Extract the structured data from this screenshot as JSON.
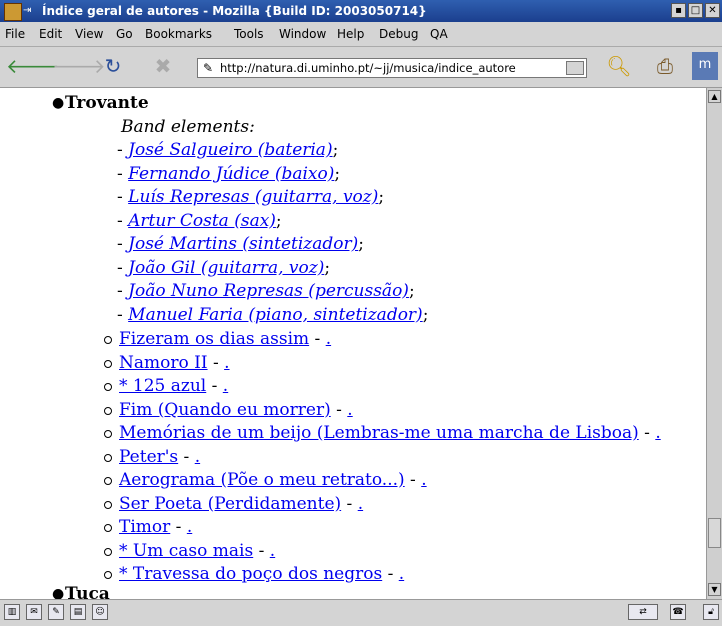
{
  "window": {
    "title": "Índice geral de autores - Mozilla {Build ID: 2003050714}"
  },
  "menu": [
    "File",
    "Edit",
    "View",
    "Go",
    "Bookmarks",
    "Tools",
    "Window",
    "Help",
    "Debug",
    "QA"
  ],
  "url": "http://natura.di.uminho.pt/~jj/musica/indice_autore",
  "icons": {
    "back": "back-arrow-icon",
    "forward": "forward-arrow-icon",
    "reload": "reload-icon",
    "stop": "stop-icon",
    "search": "search-icon",
    "print": "print-icon",
    "throbber": "mozilla-throbber-icon"
  },
  "content": {
    "artist": "Trovante",
    "band_label": "Band elements:",
    "members": [
      "José Salgueiro (bateria)",
      "Fernando Júdice (baixo)",
      "Luís Represas (guitarra, voz)",
      "Artur Costa (sax)",
      "José Martins (sintetizador)",
      "João Gil (guitarra, voz)",
      "João Nuno Represas (percussão)",
      "Manuel Faria (piano, sintetizador)"
    ],
    "member_prefix": "- ",
    "member_suffix": ";",
    "songs": [
      "Fizeram os dias assim",
      "Namoro II",
      "* 125 azul",
      "Fim (Quando eu morrer)",
      "Memórias de um beijo (Lembras-me uma marcha de Lisboa)",
      "Peter's",
      "Aerograma (Põe o meu retrato...)",
      "Ser Poeta (Perdidamente)",
      "Timor",
      "* Um caso mais",
      "* Travessa do poço dos negros"
    ],
    "song_sep": " - ",
    "song_link": ".",
    "next_artist": "Tuca"
  }
}
